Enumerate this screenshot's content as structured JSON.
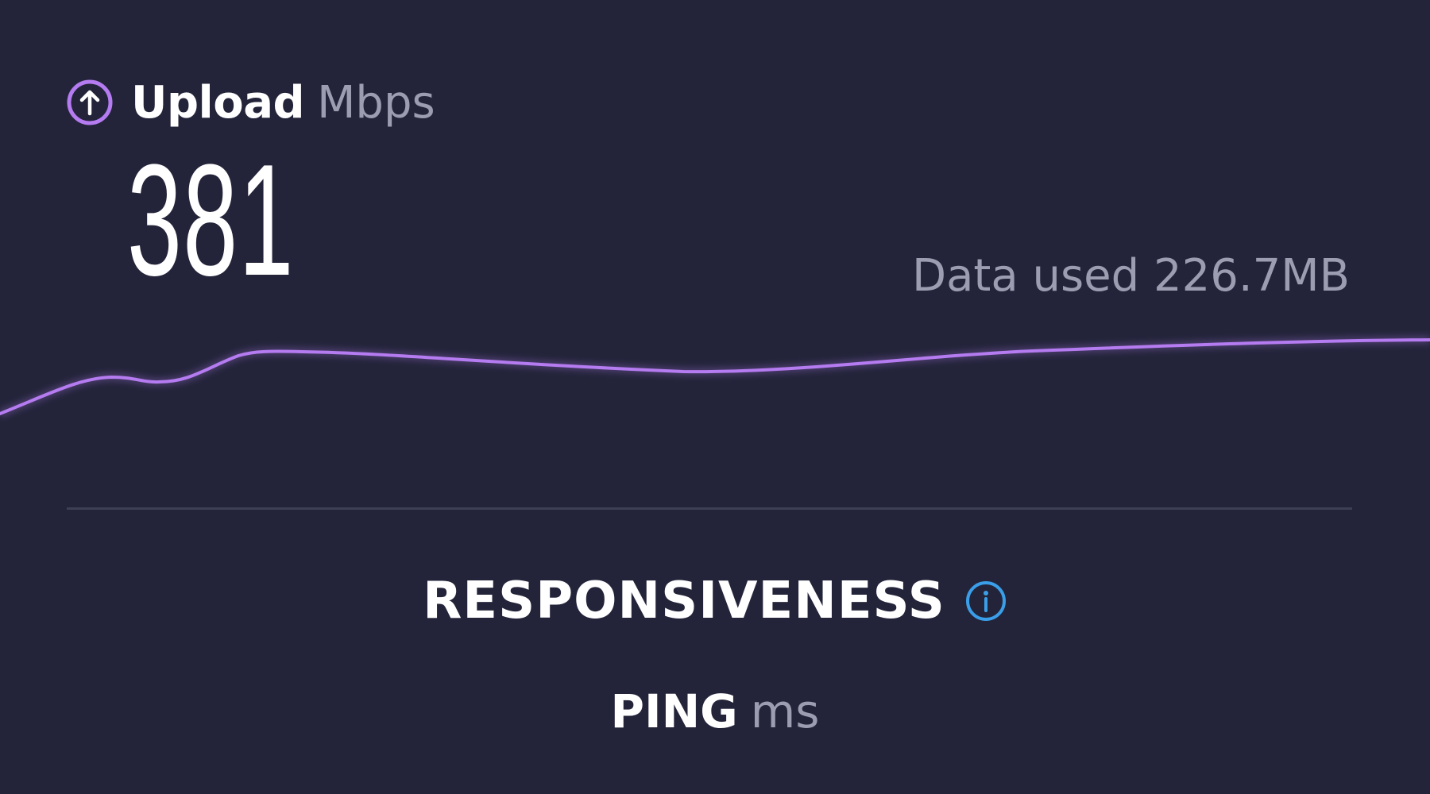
{
  "colors": {
    "background": "#23243a",
    "upload_accent": "#b57bf0",
    "info_accent": "#3a9fe8",
    "muted_text": "#9c9db0",
    "divider": "#3d3f55"
  },
  "upload": {
    "icon": "arrow-up-circle-icon",
    "title": "Upload",
    "unit": "Mbps",
    "value": "381",
    "data_used": "Data used 226.7MB"
  },
  "responsiveness": {
    "title": "RESPONSIVENESS",
    "icon": "info-icon"
  },
  "ping": {
    "label": "PING",
    "unit": "ms"
  }
}
